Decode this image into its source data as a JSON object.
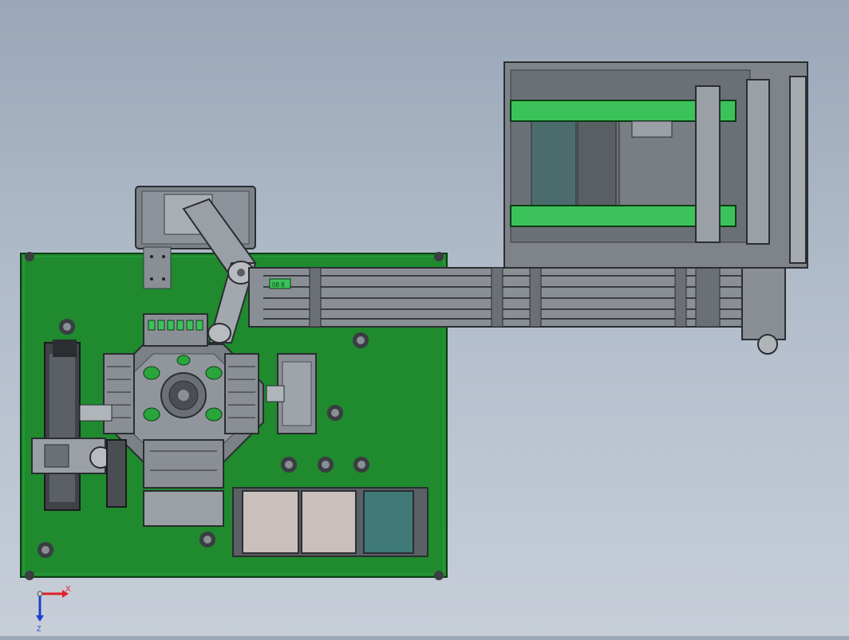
{
  "colors": {
    "background_top": "#9aa7b8",
    "background_bottom": "#c7ced8",
    "base_plate": "#1f8a2e",
    "machine_gray": "#8a8f95",
    "frame_dark": "#3a3d41",
    "belt_green": "#3cc25a",
    "tray_light": "#c9bfbb",
    "tray_teal": "#3f7a78",
    "axis_x": "#e0202a",
    "axis_y": "#1a3fd0",
    "axis_z": "#c8c8c8"
  },
  "triad": {
    "x_label": "X",
    "z_label": "Z"
  },
  "labels": {
    "conveyor_tag": "08 8"
  }
}
